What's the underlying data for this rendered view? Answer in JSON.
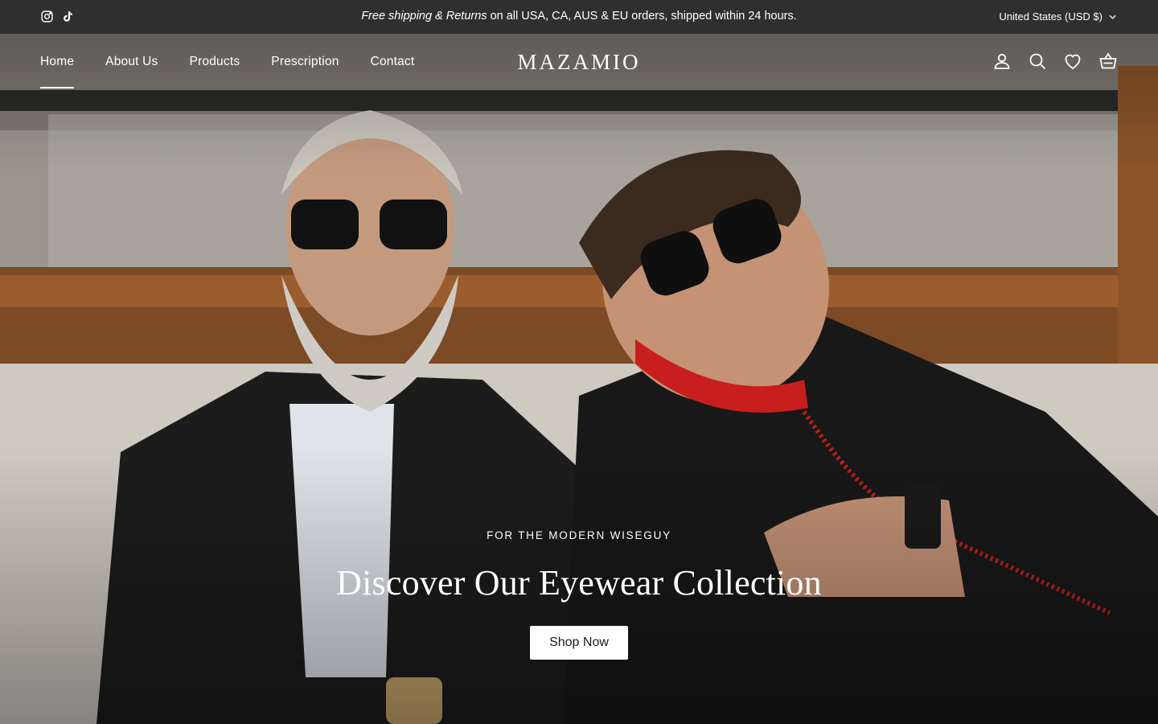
{
  "announcement": {
    "italic_text": "Free shipping & Returns",
    "text": " on all USA, CA, AUS & EU orders, shipped within 24 hours.",
    "currency": "United States (USD $)"
  },
  "social_icons": [
    "instagram-icon",
    "tiktok-icon"
  ],
  "nav": {
    "links": [
      "Home",
      "About Us",
      "Products",
      "Prescription",
      "Contact"
    ],
    "active": "Home",
    "logo": "MAZAMIO",
    "icons": [
      "account-icon",
      "search-icon",
      "wishlist-heart-icon",
      "cart-basket-icon"
    ]
  },
  "hero": {
    "kicker": "FOR THE MODERN WISEGUY",
    "headline": "Discover Our Eyewear Collection",
    "cta_label": "Shop Now"
  },
  "colors": {
    "announcement_bg": "#2f2f2f",
    "cta_bg": "#ffffff",
    "cta_text": "#1a1a1a"
  }
}
